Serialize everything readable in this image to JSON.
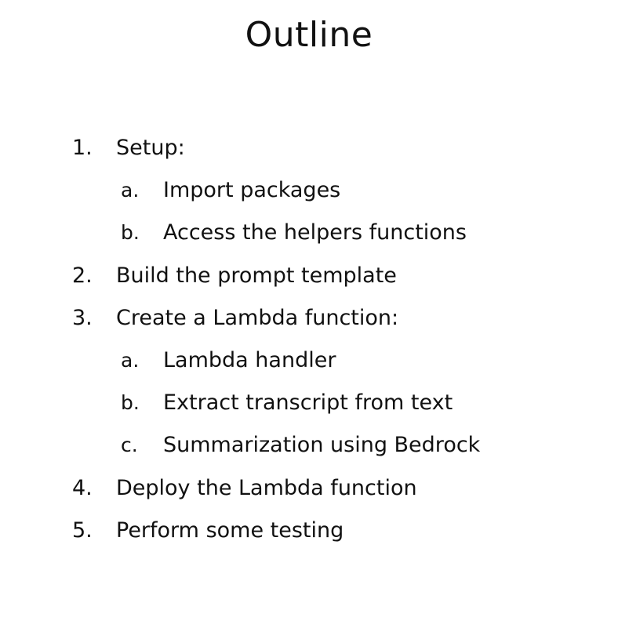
{
  "slide": {
    "title": "Outline",
    "items": [
      {
        "marker": "1.",
        "text": "Setup:",
        "level": 1
      },
      {
        "marker": "a.",
        "text": "Import packages",
        "level": 2
      },
      {
        "marker": "b.",
        "text": "Access the helpers functions",
        "level": 2
      },
      {
        "marker": "2.",
        "text": "Build the prompt template",
        "level": 1
      },
      {
        "marker": "3.",
        "text": "Create a Lambda function:",
        "level": 1
      },
      {
        "marker": "a.",
        "text": "Lambda handler",
        "level": 2
      },
      {
        "marker": "b.",
        "text": "Extract transcript from text",
        "level": 2
      },
      {
        "marker": "c.",
        "text": "Summarization using Bedrock",
        "level": 2
      },
      {
        "marker": "4.",
        "text": "Deploy the Lambda function",
        "level": 1
      },
      {
        "marker": "5.",
        "text": "Perform some testing",
        "level": 1
      }
    ]
  }
}
